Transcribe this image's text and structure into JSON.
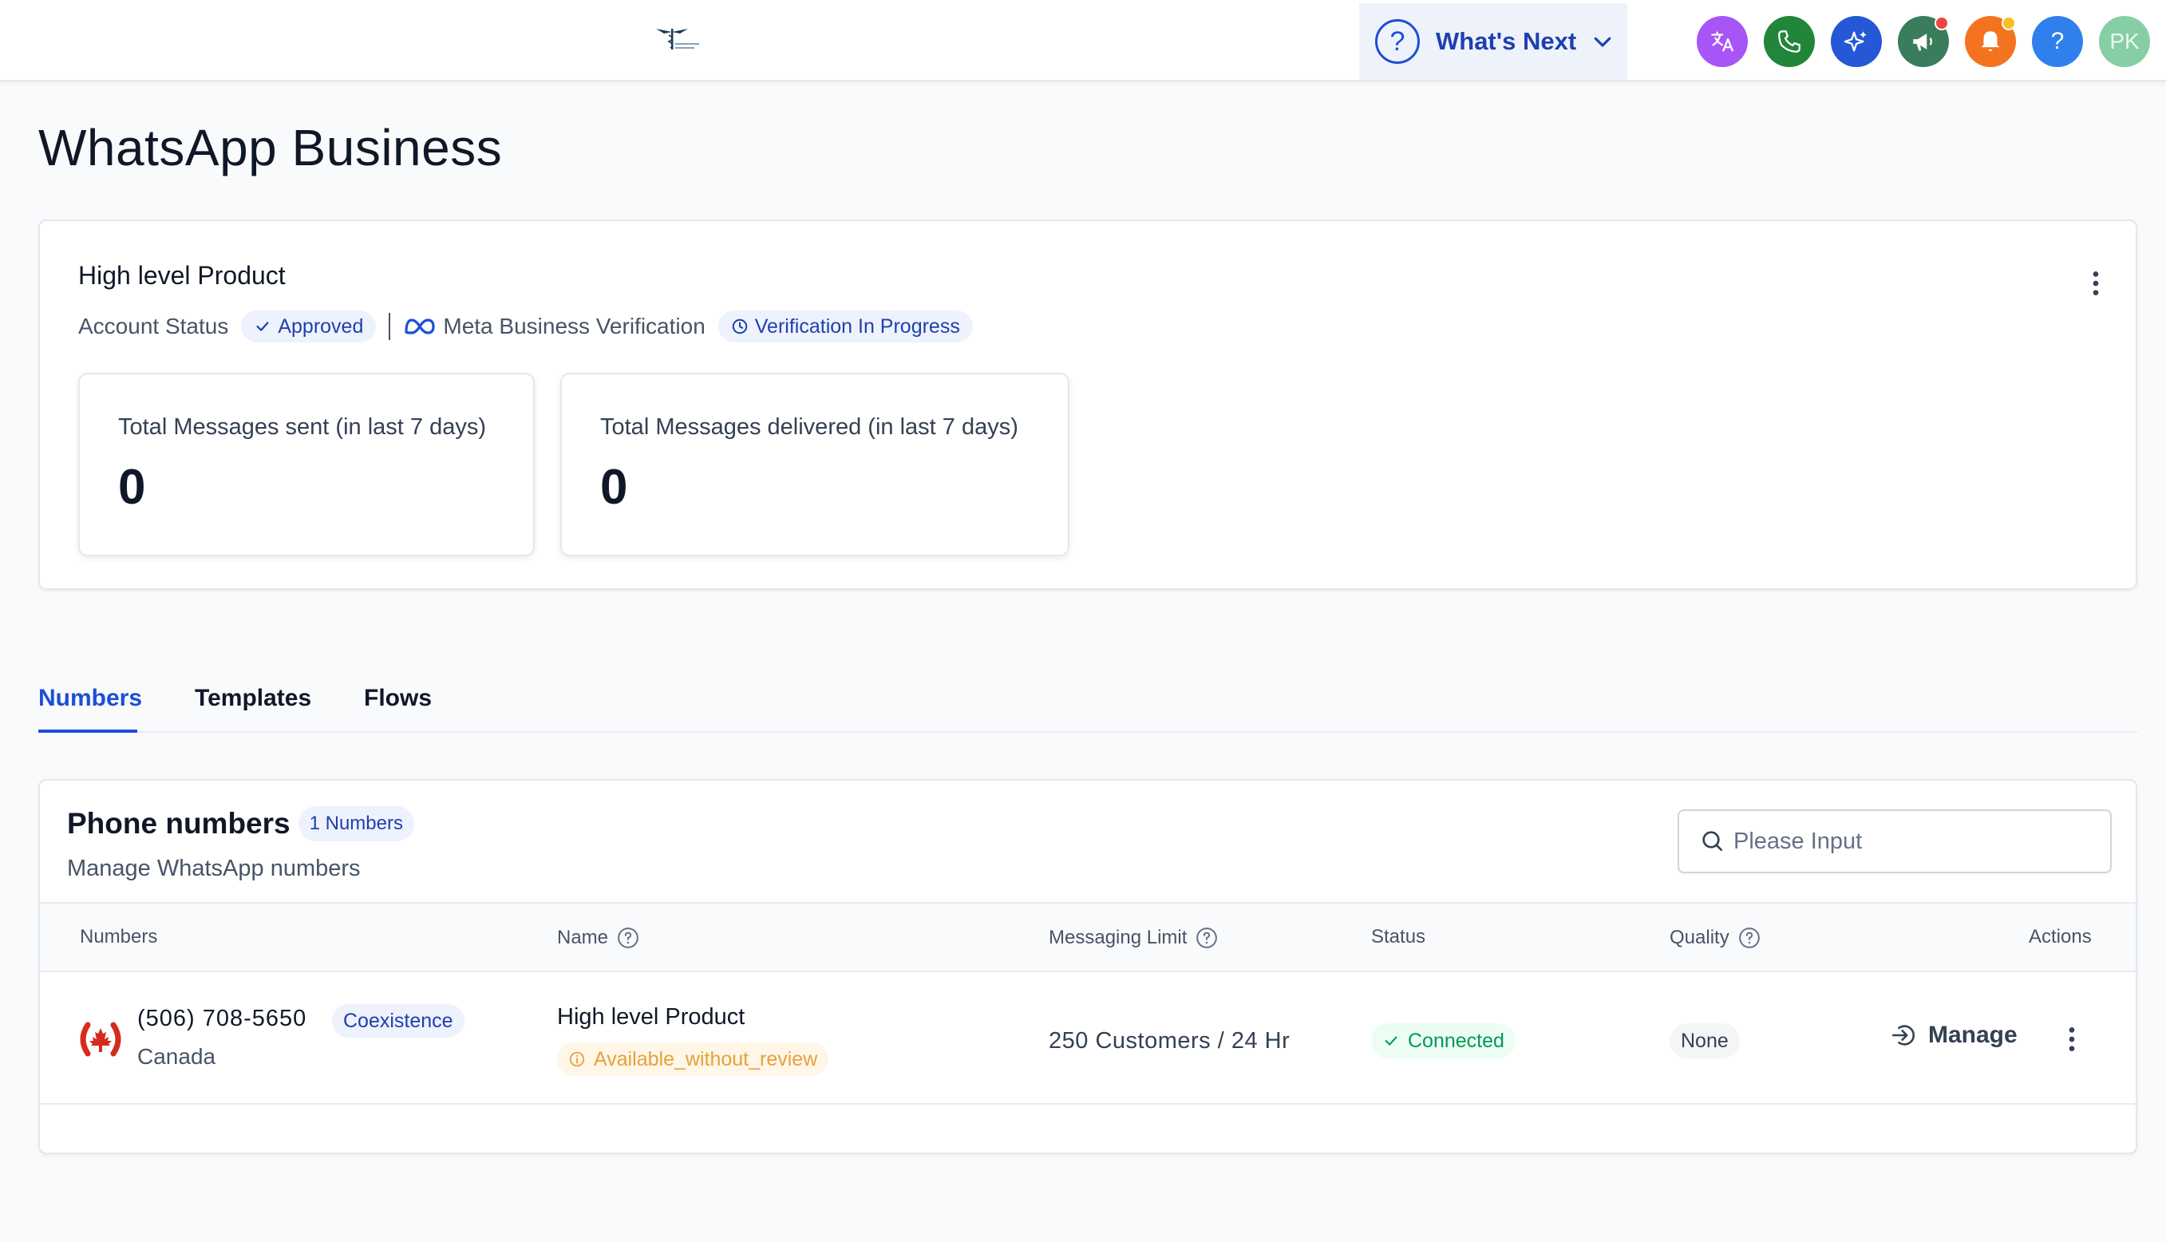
{
  "topbar": {
    "whats_next_label": "What's Next",
    "icons": [
      {
        "name": "translate-icon",
        "color": "#a855f7"
      },
      {
        "name": "phone-icon",
        "color": "#22863a"
      },
      {
        "name": "sparkle-icon",
        "color": "#2557d6"
      },
      {
        "name": "megaphone-icon",
        "color": "#3a7d5c",
        "dot_color": "#ef4444"
      },
      {
        "name": "bell-icon",
        "color": "#f4731f",
        "dot_color": "#fbbf24"
      },
      {
        "name": "help-icon",
        "color": "#2f80ed"
      }
    ],
    "avatar_initials": "PK"
  },
  "page": {
    "title": "WhatsApp Business"
  },
  "account": {
    "name": "High level Product",
    "status_label": "Account Status",
    "status_badge": "Approved",
    "meta_label": "Meta Business Verification",
    "verification_badge": "Verification In Progress",
    "stats": [
      {
        "label": "Total Messages sent (in last 7 days)",
        "value": "0"
      },
      {
        "label": "Total Messages delivered (in last 7 days)",
        "value": "0"
      }
    ]
  },
  "tabs": [
    {
      "label": "Numbers",
      "active": true
    },
    {
      "label": "Templates",
      "active": false
    },
    {
      "label": "Flows",
      "active": false
    }
  ],
  "numbers": {
    "title": "Phone numbers",
    "count_badge": "1 Numbers",
    "subtitle": "Manage WhatsApp numbers",
    "search_placeholder": "Please Input",
    "columns": {
      "numbers": "Numbers",
      "name": "Name",
      "messaging_limit": "Messaging Limit",
      "status": "Status",
      "quality": "Quality",
      "actions": "Actions"
    },
    "rows": [
      {
        "phone": "(506) 708-5650",
        "type_badge": "Coexistence",
        "country": "Canada",
        "name": "High level Product",
        "name_badge": "Available_without_review",
        "messaging_limit": "250 Customers / 24 Hr",
        "status": "Connected",
        "quality": "None",
        "action_label": "Manage"
      }
    ]
  },
  "colors": {
    "accent": "#1d4ed8",
    "success": "#039855",
    "warning": "#e6a23c"
  }
}
